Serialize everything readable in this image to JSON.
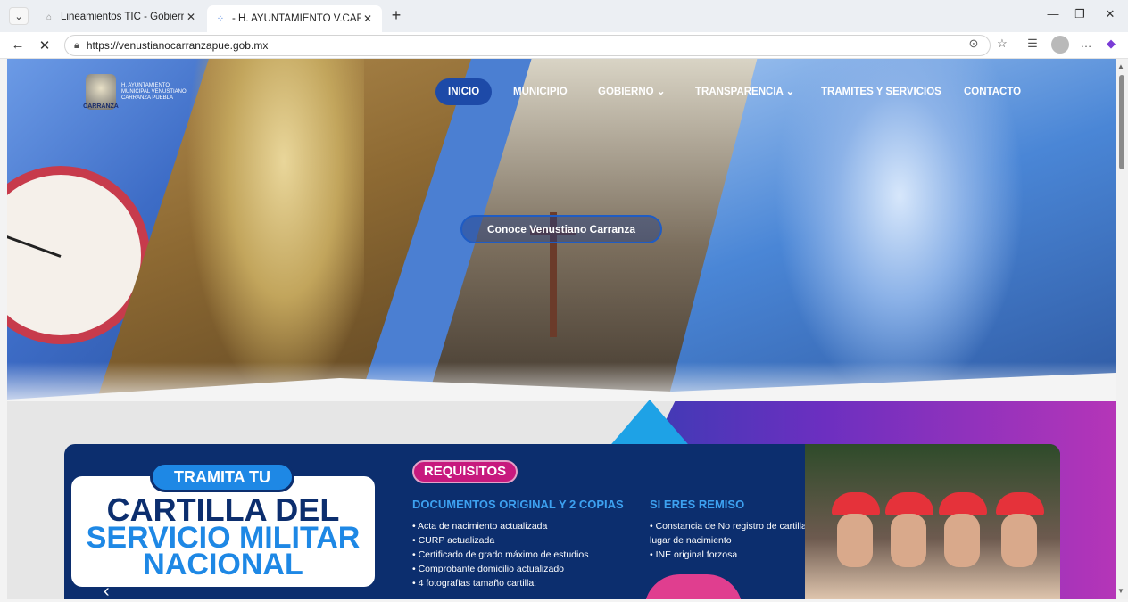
{
  "tabs": [
    {
      "title": "Lineamientos TIC - Gobierno de T",
      "active": false
    },
    {
      "title": "- H. AYUNTAMIENTO V.CARRANZ",
      "active": true
    }
  ],
  "address": {
    "url": "https://venustianocarranzapue.gob.mx"
  },
  "logo": {
    "seal_text": "CARRANZA",
    "caption": "H. AYUNTAMIENTO MUNICIPAL VENUSTIANO CARRANZA PUEBLA"
  },
  "menu": {
    "inicio": "INICIO",
    "municipio": "MUNICIPIO",
    "gobierno": "GOBIERNO",
    "transparencia": "TRANSPARENCIA",
    "tramites": "TRAMITES Y SERVICIOS",
    "contacto": "CONTACTO"
  },
  "hero": {
    "cta": "Conoce Venustiano Carranza"
  },
  "banner": {
    "tramita": "TRAMITA TU",
    "line1": "CARTILLA DEL",
    "line2": "SERVICIO MILITAR",
    "line3": "NACIONAL",
    "requisitos": "REQUISITOS",
    "docs_head": "DOCUMENTOS ORIGINAL Y 2 COPIAS",
    "docs": [
      "Acta de nacimiento actualizada",
      "CURP actualizada",
      "Certificado de grado máximo de estudios",
      "Comprobante domicilio actualizado",
      "4 fotografías tamaño cartilla:"
    ],
    "remiso_head": "SI ERES REMISO",
    "remiso": [
      "Constancia de No registro de cartilla del lugar de nacimiento",
      "INE original forzosa"
    ]
  },
  "colors": {
    "accent": "#1d4aa8",
    "banner": "#0c2e6e",
    "magenta": "#c7197e",
    "sky": "#3da1f0"
  }
}
